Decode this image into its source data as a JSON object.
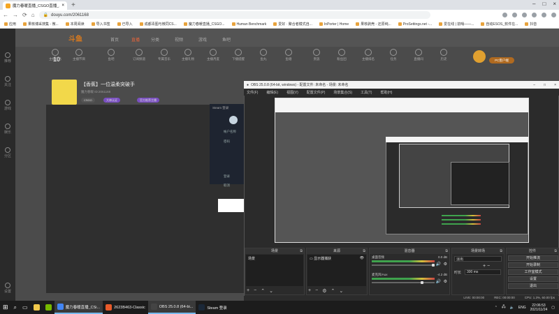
{
  "browser": {
    "tab_title": "魔力春暖直播_CSGO直播_斗鱼直播",
    "new_tab": "+",
    "url": "douyu.com/2061168",
    "bookmarks": [
      "应用",
      "果核博采搜集 - 微...",
      "本周阅读",
      "导入书签",
      "已导入",
      "成都青图与微同CS...",
      "魔力春暖直播_CSGO...",
      "Human Benchmark",
      "爱好 · 聚合者模式自...",
      "InPorter | Home",
      "果核剥壳 - 还原纯...",
      "ProSettings.net -...",
      "爱在线 | 前哨——...",
      "自动ESOS_软件在...",
      "抖音"
    ]
  },
  "site": {
    "logo": "斗鱼",
    "nav": [
      "首页",
      "直播",
      "分类",
      "视频",
      "游戏",
      "鱼吧"
    ],
    "level": "10",
    "icons": [
      "主播任务",
      "主播节目",
      "鱼吧",
      "订阅频道",
      "专属音乐",
      "主播礼物",
      "主播月度",
      "下播提醒",
      "鱼丸",
      "鱼塘",
      "贵族",
      "粉丝团",
      "主播排名",
      "任务",
      "直播间",
      "历史"
    ],
    "pc_button": "PC客户端",
    "room_title": "【香蕉】一位温柔突破手",
    "room_sub": "魔力春暖  ID:2061168",
    "pills": [
      "CSGO",
      "大神认证",
      "官方推荐主播"
    ],
    "sidebar_labels": [
      "推荐",
      "关注",
      "游戏",
      "娱乐",
      "分区",
      "设置"
    ]
  },
  "steam": {
    "title": "Steam 登录",
    "account_label": "帐户名称",
    "password_label": "密码",
    "login_label": "登录",
    "cancel_label": "取消"
  },
  "obs": {
    "title": "OBS 25.0.8 (64-bit, windows) - 配置文件: 未命名 - 场景: 未命名",
    "menu": [
      "文件(F)",
      "编辑(E)",
      "视图(V)",
      "配置文件(P)",
      "场景集合(S)",
      "工具(T)",
      "帮助(H)"
    ],
    "docks": {
      "scenes": {
        "header": "场景",
        "items": [
          "场景"
        ]
      },
      "sources": {
        "header": "来源",
        "items": [
          "显示器捕获"
        ]
      },
      "mixer": {
        "header": "混音器",
        "channels": [
          {
            "name": "桌面音频",
            "db": "0.0 dB",
            "level": 0.75
          },
          {
            "name": "麦克风/Aux",
            "db": "-4.2 dB",
            "level": 0.55
          }
        ]
      },
      "transitions": {
        "header": "场景转场",
        "type": "淡出",
        "duration_label": "时长",
        "duration": "300 ms"
      },
      "controls": {
        "header": "控件",
        "buttons": [
          "开始推流",
          "开始录制",
          "工作室模式",
          "设置",
          "退出"
        ]
      }
    },
    "status": [
      "LIVE: 00:00:00",
      "REC: 00:00:00",
      "CPU: 1.3%, 60.00 fps"
    ]
  },
  "taskbar": {
    "items": [
      {
        "label": "魔力春暖直播_CSi...",
        "color": "#4285f4",
        "active": true
      },
      {
        "label": "2623B463-Classic",
        "color": "#e85a2a",
        "active": false
      },
      {
        "label": "OBS 25.0.8 (64-bi...",
        "color": "#444444",
        "active": true
      },
      {
        "label": "Steam 登录",
        "color": "#1b2838",
        "active": false
      }
    ],
    "lang": "ENG",
    "time": "22:06:53",
    "date": "2021/11/24"
  }
}
